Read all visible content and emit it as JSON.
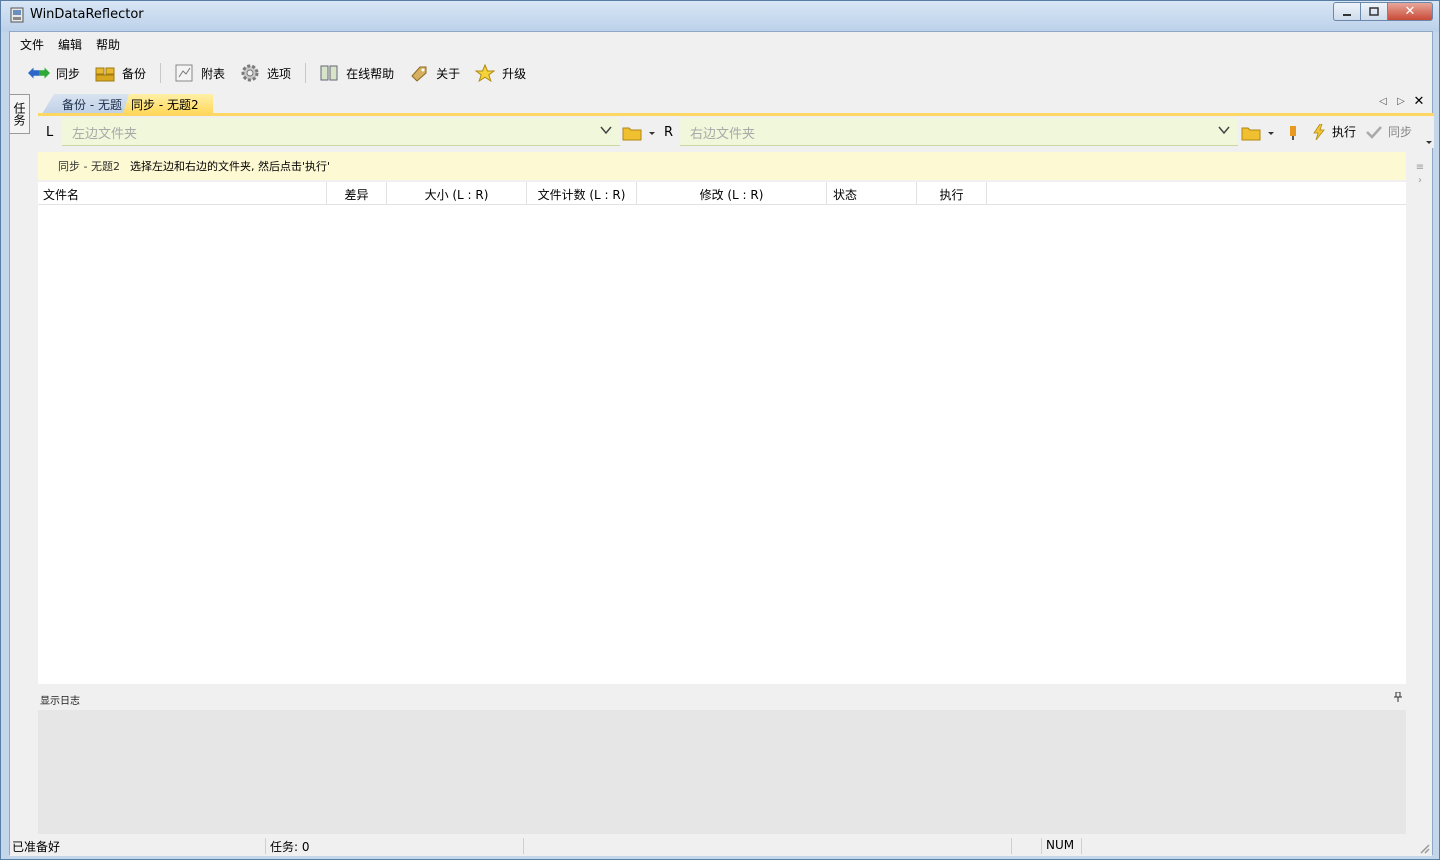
{
  "window": {
    "title": "WinDataReflector"
  },
  "menu": [
    "文件",
    "编辑",
    "帮助"
  ],
  "toolbar": {
    "sync": "同步",
    "backup": "备份",
    "appendix": "附表",
    "options": "选项",
    "online_help": "在线帮助",
    "about": "关于",
    "upgrade": "升级"
  },
  "side_tab": "任务",
  "tabs": {
    "backup": "备份 - 无题",
    "sync": "同步 - 无题2"
  },
  "paths": {
    "left_letter": "L",
    "right_letter": "R",
    "left_placeholder": "左边文件夹",
    "right_placeholder": "右边文件夹",
    "execute": "执行",
    "sync": "同步"
  },
  "infobar": {
    "title": "同步 - 无题2",
    "message": "选择左边和右边的文件夹, 然后点击'执行'"
  },
  "grid": {
    "columns": [
      "文件名",
      "差异",
      "大小 (L : R)",
      "文件计数 (L : R)",
      "修改 (L : R)",
      "状态",
      "执行"
    ]
  },
  "log": {
    "label": "显示日志"
  },
  "status": {
    "ready": "已准备好",
    "tasks": "任务: 0",
    "num": "NUM"
  },
  "colors": {
    "accent_yellow": "#fdd761",
    "path_bg": "#f0f7db",
    "info_bg": "#fdf9d3"
  }
}
